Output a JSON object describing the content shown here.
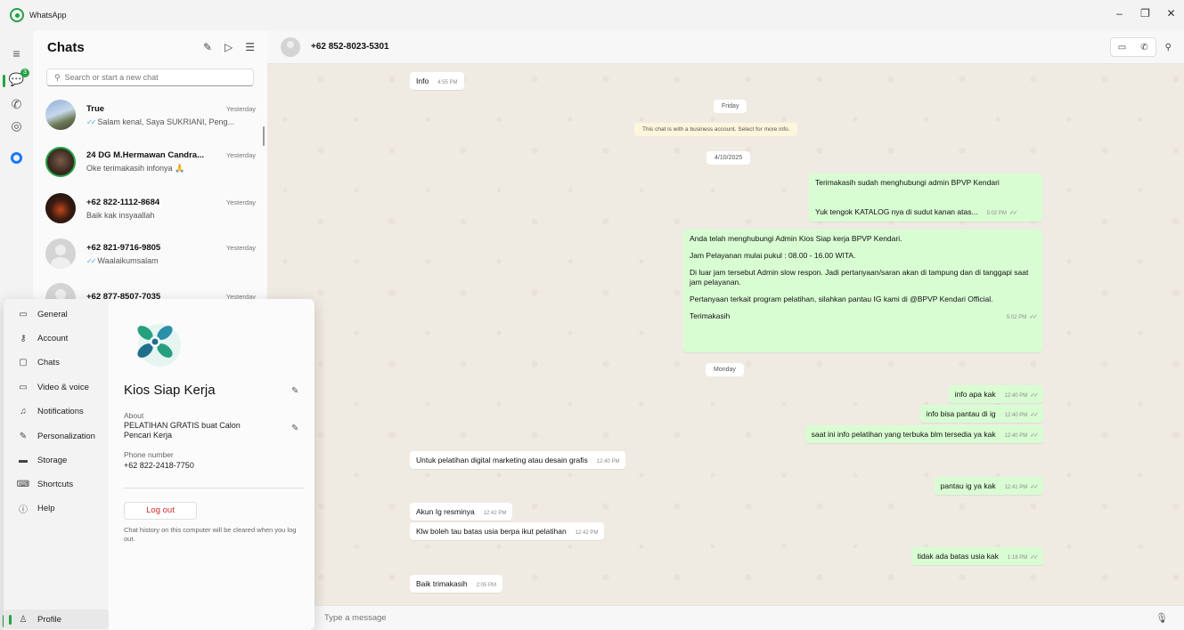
{
  "window": {
    "title": "WhatsApp",
    "controls": [
      "–",
      "❐",
      "✕"
    ]
  },
  "rail": {
    "unread_badge": "3"
  },
  "chatlist": {
    "title": "Chats",
    "search_placeholder": "Search or start a new chat",
    "chats": [
      {
        "name": "True",
        "time": "Yesterday",
        "message": "Salam kenal, Saya SUKRIANI, Peng...",
        "ticks": true
      },
      {
        "name": "24 DG M.Hermawan Candra...",
        "time": "Yesterday",
        "message": "Oke terimakasih infonya 🙏",
        "ticks": false
      },
      {
        "name": "+62 822-1112-8684",
        "time": "Yesterday",
        "message": "Baik kak insyaallah",
        "ticks": false
      },
      {
        "name": "+62 821-9716-9805",
        "time": "Yesterday",
        "message": "Waalaikumsalam",
        "ticks": true
      },
      {
        "name": "+62 877-8507-7035",
        "time": "Yesterday",
        "message": "",
        "ticks": false
      }
    ]
  },
  "settings": {
    "nav": [
      "General",
      "Account",
      "Chats",
      "Video & voice",
      "Notifications",
      "Personalization",
      "Storage",
      "Shortcuts",
      "Help"
    ],
    "profile_label": "Profile",
    "profile": {
      "name": "Kios Siap Kerja",
      "about_label": "About",
      "about": "PELATIHAN GRATIS buat Calon Pencari Kerja",
      "phone_label": "Phone number",
      "phone": "+62 822-2418-7750",
      "logout_label": "Log out",
      "logout_note": "Chat history on this computer will be cleared when you log out."
    }
  },
  "conversation": {
    "contact": "+62 852-8023-5301",
    "composer_placeholder": "Type a message",
    "pills": {
      "friday": "Friday",
      "business": "This chat is with a business account. Select for more info.",
      "date": "4/10/2025",
      "monday": "Monday"
    },
    "messages": {
      "m_info": {
        "text": "Info",
        "time": "4:55 PM"
      },
      "m_thanks": {
        "text": "Terimakasih sudah menghubungi admin BPVP Kendari"
      },
      "m_katalog": {
        "text": "Yuk tengok KATALOG nya di sudut kanan atas...",
        "time": "5:02 PM"
      },
      "m_auto": {
        "p1": "Anda telah menghubungi Admin Kios Siap kerja BPVP Kendari.",
        "p2": "Jam Pelayanan mulai pukul : 08.00 - 16.00 WITA.",
        "p3": "Di luar jam tersebut Admin slow respon. Jadi pertanyaan/saran akan di tampung dan di tanggapi saat jam pelayanan.",
        "p4": "Pertanyaan terkait program pelatihan, silahkan pantau IG kami di @BPVP Kendari Official.",
        "p5": "Terimakasih",
        "time": "5:02 PM"
      },
      "m1": {
        "text": "info apa kak",
        "time": "12:40 PM"
      },
      "m2": {
        "text": "info bisa pantau di ig",
        "time": "12:40 PM"
      },
      "m3": {
        "text": "saat ini info pelatihan yang terbuka blm tersedia ya kak",
        "time": "12:40 PM"
      },
      "m4": {
        "text": "Untuk pelatihan digital marketing atau desain grafis",
        "time": "12:40 PM"
      },
      "m5": {
        "text": "pantau ig ya kak",
        "time": "12:41 PM"
      },
      "m6": {
        "text": "Akun Ig resminya",
        "time": "12:42 PM"
      },
      "m7": {
        "text": "Klw boleh tau batas usia berpa ikut pelatihan",
        "time": "12:42 PM"
      },
      "m8": {
        "text": "tidak ada batas usia kak",
        "time": "1:18 PM"
      },
      "m9": {
        "text": "Baik trimakasih",
        "time": "2:05 PM"
      }
    }
  },
  "colors": {
    "accent": "#25a244",
    "outgoing_bubble": "#d9fdd3",
    "chat_bg": "#efeae2",
    "logout": "#d32a2a"
  }
}
